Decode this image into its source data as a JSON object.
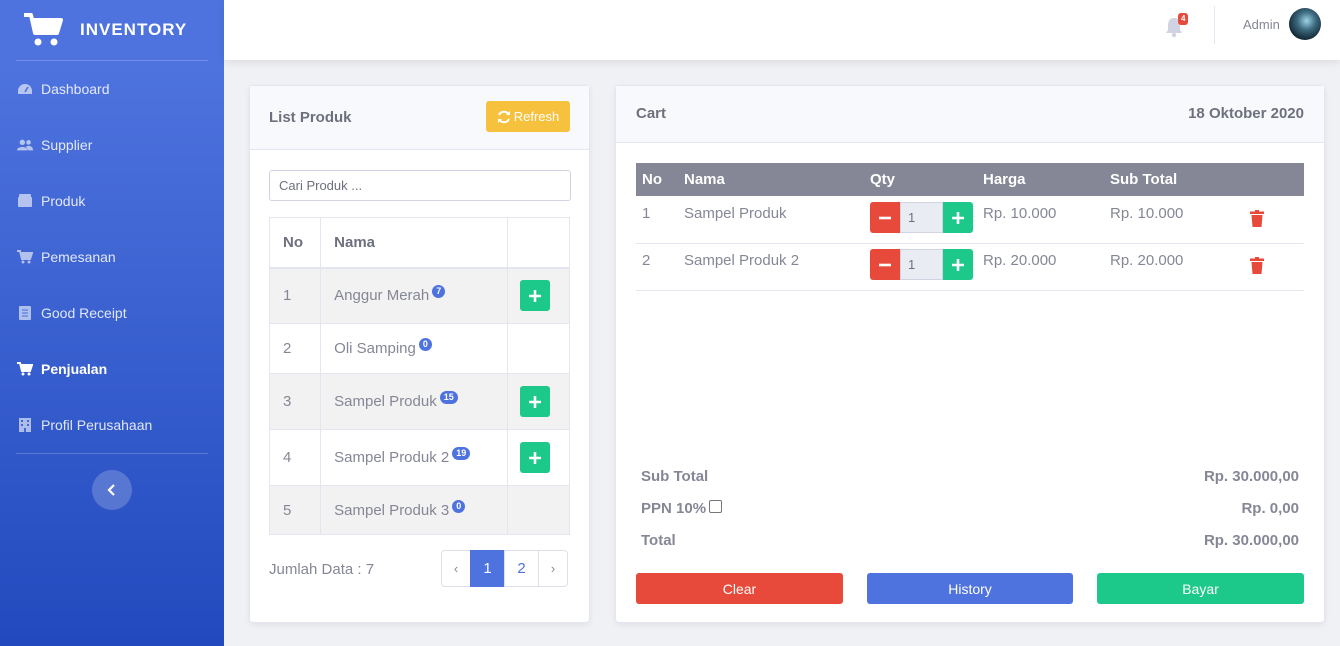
{
  "brand": {
    "name": "INVENTORY",
    "icon": "cart-icon"
  },
  "sidebar": {
    "items": [
      {
        "label": "Dashboard",
        "icon": "tachometer-icon"
      },
      {
        "label": "Supplier",
        "icon": "users-icon"
      },
      {
        "label": "Produk",
        "icon": "box-icon"
      },
      {
        "label": "Pemesanan",
        "icon": "cart-icon"
      },
      {
        "label": "Good Receipt",
        "icon": "document-icon"
      },
      {
        "label": "Penjualan",
        "icon": "cart-icon",
        "active": true
      },
      {
        "label": "Profil Perusahaan",
        "icon": "building-icon"
      }
    ],
    "toggle_icon": "chevron-left-icon"
  },
  "topbar": {
    "notification_count": "4",
    "user_name": "Admin"
  },
  "product_list": {
    "title": "List Produk",
    "refresh_label": "Refresh",
    "search_placeholder": "Cari Produk ...",
    "columns": [
      "No",
      "Nama",
      ""
    ],
    "rows": [
      {
        "no": "1",
        "name": "Anggur Merah",
        "stock": "7",
        "can_add": true
      },
      {
        "no": "2",
        "name": "Oli Samping",
        "stock": "0",
        "can_add": false
      },
      {
        "no": "3",
        "name": "Sampel Produk",
        "stock": "15",
        "can_add": true
      },
      {
        "no": "4",
        "name": "Sampel Produk 2",
        "stock": "19",
        "can_add": true
      },
      {
        "no": "5",
        "name": "Sampel Produk 3",
        "stock": "0",
        "can_add": false
      }
    ],
    "total_label": "Jumlah Data : 7",
    "pagination": {
      "prev": "‹",
      "pages": [
        "1",
        "2"
      ],
      "current": "1",
      "next": "›"
    }
  },
  "cart": {
    "title": "Cart",
    "date": "18 Oktober 2020",
    "columns": [
      "No",
      "Nama",
      "Qty",
      "Harga",
      "Sub Total"
    ],
    "items": [
      {
        "no": "1",
        "name": "Sampel Produk",
        "qty": "1",
        "price": "Rp. 10.000",
        "subtotal": "Rp. 10.000"
      },
      {
        "no": "2",
        "name": "Sampel Produk 2",
        "qty": "1",
        "price": "Rp. 20.000",
        "subtotal": "Rp. 20.000"
      }
    ],
    "summary": {
      "subtotal_label": "Sub Total",
      "subtotal_value": "Rp. 30.000,00",
      "ppn_label": "PPN 10%",
      "ppn_value": "Rp. 0,00",
      "total_label": "Total",
      "total_value": "Rp. 30.000,00"
    },
    "buttons": {
      "clear": "Clear",
      "history": "History",
      "pay": "Bayar"
    }
  },
  "colors": {
    "primary": "#4e73df",
    "success": "#1cc88a",
    "danger": "#e74a3b",
    "warning": "#f6c23e",
    "secondary": "#858796"
  }
}
